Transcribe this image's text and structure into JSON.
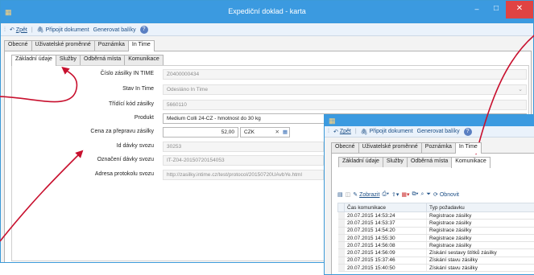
{
  "main": {
    "title": "Expediční doklad - karta",
    "toolbar": {
      "back": "Zpět",
      "attach": "Připojit dokument",
      "generate": "Generovat balíky"
    },
    "tabs": [
      "Obecné",
      "Uživatelské proměnné",
      "Poznámka",
      "In Time"
    ],
    "subtabs": [
      "Základní údaje",
      "Služby",
      "Odběrná místa",
      "Komunikace"
    ],
    "fields": {
      "cislo": {
        "label": "Číslo zásilky IN TIME",
        "value": "Z0400000434"
      },
      "stav": {
        "label": "Stav In Time",
        "value": "Odesláno In Time"
      },
      "tridici": {
        "label": "Třídící kód zásilky",
        "value": "5660110"
      },
      "produkt": {
        "label": "Produkt",
        "value": "Medium Colli 24-CZ - hmotnost do 30 kg"
      },
      "cena": {
        "label": "Cena za přepravu zásilky",
        "value": "52,00",
        "currency": "CZK"
      },
      "id_davky": {
        "label": "Id dávky svozu",
        "value": "30253"
      },
      "oznaceni": {
        "label": "Označení dávky svozu",
        "value": "IT-Z04-20150720154053"
      },
      "adresa": {
        "label": "Adresa protokolu svozu",
        "value": "http://zasilky.intime.cz/test/protocol/20150720UAvbYe.html"
      }
    }
  },
  "overlay": {
    "toolbar": {
      "back": "Zpět",
      "attach": "Připojit dokument",
      "generate": "Generovat balíky"
    },
    "tabs": [
      "Obecné",
      "Uživatelské proměnné",
      "Poznámka",
      "In Time"
    ],
    "subtabs": [
      "Základní údaje",
      "Služby",
      "Odběrná místa",
      "Komunikace"
    ],
    "grid_toolbar": {
      "show": "Zobrazit",
      "refresh": "Obnovit"
    },
    "columns": [
      "Čas komunikace",
      "Typ požadavku"
    ],
    "rows": [
      [
        "20.07.2015 14:53:24",
        "Registrace zásilky"
      ],
      [
        "20.07.2015 14:53:37",
        "Registrace zásilky"
      ],
      [
        "20.07.2015 14:54:20",
        "Registrace zásilky"
      ],
      [
        "20.07.2015 14:55:30",
        "Registrace zásilky"
      ],
      [
        "20.07.2015 14:56:08",
        "Registrace zásilky"
      ],
      [
        "20.07.2015 14:56:09",
        "Získání sestavy štítků zásilky"
      ],
      [
        "20.07.2015 15:37:46",
        "Získání stavu zásilky"
      ],
      [
        "20.07.2015 15:40:50",
        "Získání stavu zásilky"
      ]
    ]
  },
  "colors": {
    "titlebar": "#3b9ae0",
    "annotation_arrow": "#c8102e",
    "close_button": "#e04343"
  }
}
